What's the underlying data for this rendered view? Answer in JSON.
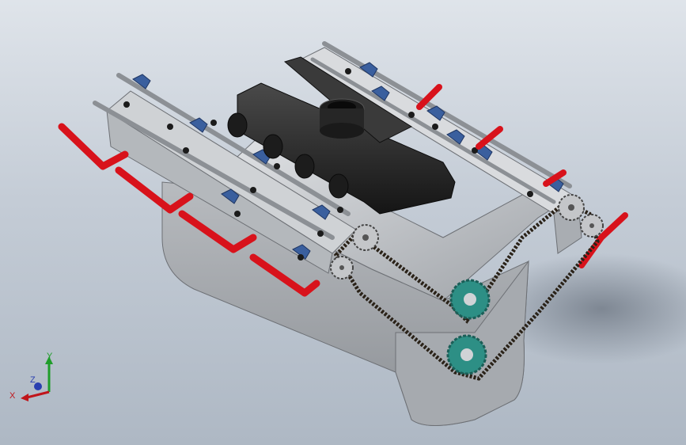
{
  "viewport": {
    "background_top": "#dfe4ea",
    "background_bottom": "#aeb8c4"
  },
  "colors": {
    "block": "#c9cbce",
    "block_dark": "#9fa2a6",
    "intake_manifold": "#2b2b2b",
    "exhaust_pipe": "#d8121b",
    "rocker_bracket": "#3a5f9e",
    "sprocket": "#2d8f85",
    "chain": "#2a2218"
  },
  "triad": {
    "x_label": "X",
    "y_label": "Y",
    "z_label": "Z",
    "x_color": "#c0151b",
    "y_color": "#1f9d2a",
    "z_color": "#2a3fb0"
  },
  "model": {
    "name_icon": "v-engine-assembly"
  }
}
